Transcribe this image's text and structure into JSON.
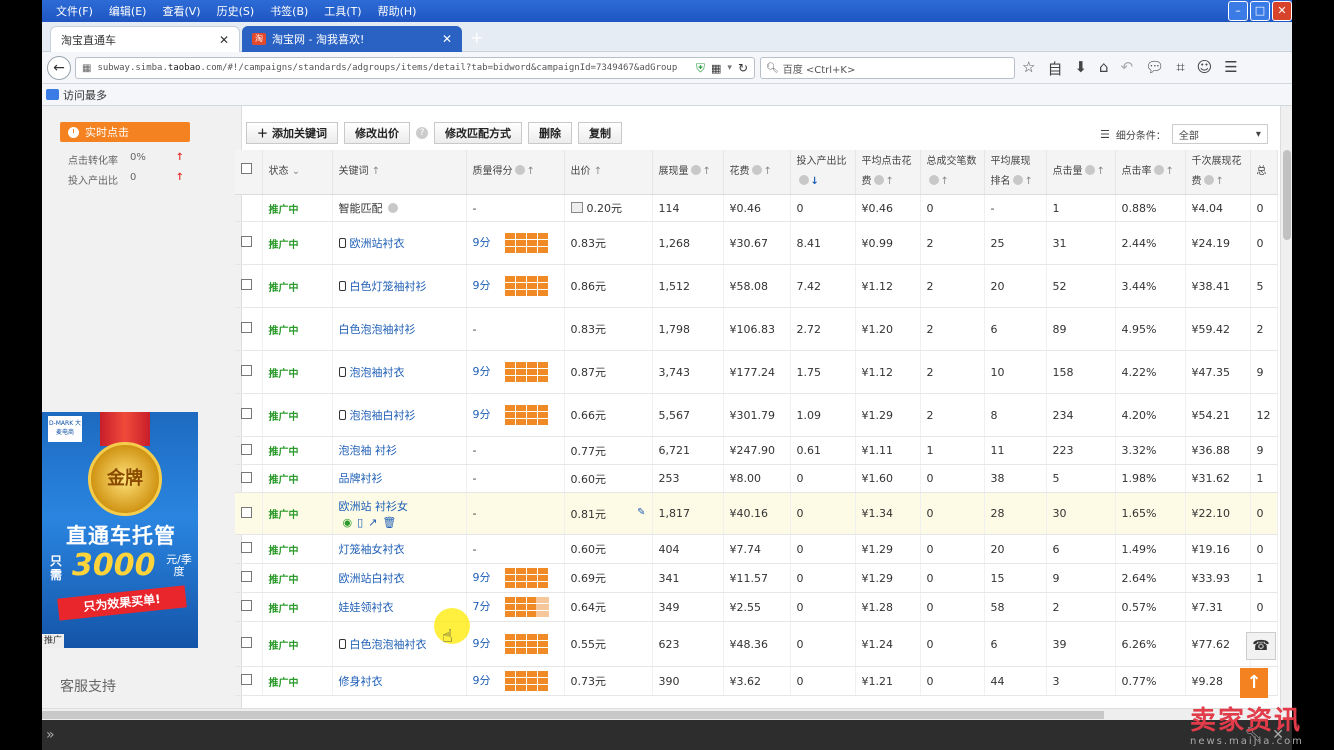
{
  "browser": {
    "menu": [
      "文件(F)",
      "编辑(E)",
      "查看(V)",
      "历史(S)",
      "书签(B)",
      "工具(T)",
      "帮助(H)"
    ],
    "tabs": [
      {
        "label": "淘宝直通车",
        "active": true
      },
      {
        "label": "淘宝网 - 淘我喜欢!",
        "active": false
      }
    ],
    "url_prefix": "subway.simba.",
    "url_domain": "taobao",
    "url_rest": ".com/#!/campaigns/standards/adgroups/items/detail?tab=bidword&campaignId=7349467&adGroup",
    "search_placeholder": "百度 <Ctrl+K>",
    "bookmark": "访问最多"
  },
  "sidebar": {
    "realtime_label": "实时点击",
    "stats": [
      {
        "label": "点击转化率",
        "value": "0%"
      },
      {
        "label": "投入产出比",
        "value": "0"
      }
    ],
    "ad": {
      "logo": "D-MARK 大麦电商",
      "medal": "金牌",
      "headline": "直通车托管",
      "only": "只需",
      "price": "3000",
      "unit": "元/季度",
      "slogan": "只为效果买单!",
      "tag": "推广"
    },
    "support": "客服支持"
  },
  "toolbar": {
    "add_keyword": "添加关键词",
    "modify_bid": "修改出价",
    "modify_match": "修改匹配方式",
    "delete": "删除",
    "copy": "复制",
    "filter_label": "细分条件：",
    "filter_value": "全部"
  },
  "columns": [
    "状态",
    "关键词",
    "质量得分",
    "出价",
    "展现量",
    "花费",
    "投入产出比",
    "平均点击花费",
    "总成交笔数",
    "平均展现排名",
    "点击量",
    "点击率",
    "千次展现花费",
    "总"
  ],
  "rows": [
    {
      "status": "推广中",
      "keyword": "智能匹配",
      "mobile": false,
      "quality": "-",
      "bid": "0.20元",
      "impressions": "114",
      "cost": "¥0.46",
      "roi": "0",
      "cpc": "¥0.46",
      "deals": "0",
      "rank": "-",
      "clicks": "1",
      "ctr": "0.88%",
      "cpm": "¥4.04",
      "total": "0"
    },
    {
      "status": "推广中",
      "keyword": "欧洲站衬衣",
      "mobile": true,
      "quality": "9分",
      "bid": "0.83元",
      "impressions": "1,268",
      "cost": "¥30.67",
      "roi": "8.41",
      "cpc": "¥0.99",
      "deals": "2",
      "rank": "25",
      "clicks": "31",
      "ctr": "2.44%",
      "cpm": "¥24.19",
      "total": "0"
    },
    {
      "status": "推广中",
      "keyword": "白色灯笼袖衬衫",
      "mobile": true,
      "quality": "9分",
      "bid": "0.86元",
      "impressions": "1,512",
      "cost": "¥58.08",
      "roi": "7.42",
      "cpc": "¥1.12",
      "deals": "2",
      "rank": "20",
      "clicks": "52",
      "ctr": "3.44%",
      "cpm": "¥38.41",
      "total": "5"
    },
    {
      "status": "推广中",
      "keyword": "白色泡泡袖衬衫",
      "mobile": false,
      "quality": "-",
      "bid": "0.83元",
      "impressions": "1,798",
      "cost": "¥106.83",
      "roi": "2.72",
      "cpc": "¥1.20",
      "deals": "2",
      "rank": "6",
      "clicks": "89",
      "ctr": "4.95%",
      "cpm": "¥59.42",
      "total": "2"
    },
    {
      "status": "推广中",
      "keyword": "泡泡袖衬衣",
      "mobile": true,
      "quality": "9分",
      "bid": "0.87元",
      "impressions": "3,743",
      "cost": "¥177.24",
      "roi": "1.75",
      "cpc": "¥1.12",
      "deals": "2",
      "rank": "10",
      "clicks": "158",
      "ctr": "4.22%",
      "cpm": "¥47.35",
      "total": "9"
    },
    {
      "status": "推广中",
      "keyword": "泡泡袖白衬衫",
      "mobile": true,
      "quality": "9分",
      "bid": "0.66元",
      "impressions": "5,567",
      "cost": "¥301.79",
      "roi": "1.09",
      "cpc": "¥1.29",
      "deals": "2",
      "rank": "8",
      "clicks": "234",
      "ctr": "4.20%",
      "cpm": "¥54.21",
      "total": "12"
    },
    {
      "status": "推广中",
      "keyword": "泡泡袖 衬衫",
      "mobile": false,
      "quality": "-",
      "bid": "0.77元",
      "impressions": "6,721",
      "cost": "¥247.90",
      "roi": "0.61",
      "cpc": "¥1.11",
      "deals": "1",
      "rank": "11",
      "clicks": "223",
      "ctr": "3.32%",
      "cpm": "¥36.88",
      "total": "9"
    },
    {
      "status": "推广中",
      "keyword": "品牌衬衫",
      "mobile": false,
      "quality": "-",
      "bid": "0.60元",
      "impressions": "253",
      "cost": "¥8.00",
      "roi": "0",
      "cpc": "¥1.60",
      "deals": "0",
      "rank": "38",
      "clicks": "5",
      "ctr": "1.98%",
      "cpm": "¥31.62",
      "total": "1"
    },
    {
      "status": "推广中",
      "keyword": "欧洲站 衬衫女",
      "mobile": false,
      "quality": "-",
      "bid": "0.81元",
      "impressions": "1,817",
      "cost": "¥40.16",
      "roi": "0",
      "cpc": "¥1.34",
      "deals": "0",
      "rank": "28",
      "clicks": "30",
      "ctr": "1.65%",
      "cpm": "¥22.10",
      "total": "0"
    },
    {
      "status": "推广中",
      "keyword": "灯笼袖女衬衣",
      "mobile": false,
      "quality": "-",
      "bid": "0.60元",
      "impressions": "404",
      "cost": "¥7.74",
      "roi": "0",
      "cpc": "¥1.29",
      "deals": "0",
      "rank": "20",
      "clicks": "6",
      "ctr": "1.49%",
      "cpm": "¥19.16",
      "total": "0"
    },
    {
      "status": "推广中",
      "keyword": "欧洲站白衬衣",
      "mobile": false,
      "quality": "9分",
      "bid": "0.69元",
      "impressions": "341",
      "cost": "¥11.57",
      "roi": "0",
      "cpc": "¥1.29",
      "deals": "0",
      "rank": "15",
      "clicks": "9",
      "ctr": "2.64%",
      "cpm": "¥33.93",
      "total": "1"
    },
    {
      "status": "推广中",
      "keyword": "娃娃领衬衣",
      "mobile": false,
      "quality": "7分",
      "bid": "0.64元",
      "impressions": "349",
      "cost": "¥2.55",
      "roi": "0",
      "cpc": "¥1.28",
      "deals": "0",
      "rank": "58",
      "clicks": "2",
      "ctr": "0.57%",
      "cpm": "¥7.31",
      "total": "0"
    },
    {
      "status": "推广中",
      "keyword": "白色泡泡袖衬衣",
      "mobile": true,
      "quality": "9分",
      "bid": "0.55元",
      "impressions": "623",
      "cost": "¥48.36",
      "roi": "0",
      "cpc": "¥1.24",
      "deals": "0",
      "rank": "6",
      "clicks": "39",
      "ctr": "6.26%",
      "cpm": "¥77.62",
      "total": "0"
    },
    {
      "status": "推广中",
      "keyword": "修身衬衣",
      "mobile": false,
      "quality": "9分",
      "bid": "0.73元",
      "impressions": "390",
      "cost": "¥3.62",
      "roi": "0",
      "cpc": "¥1.21",
      "deals": "0",
      "rank": "44",
      "clicks": "3",
      "ctr": "0.77%",
      "cpm": "¥9.28",
      "total": "0"
    }
  ],
  "watermark": "卖家资讯",
  "watermark_sub": "news.maijia.com",
  "colors": {
    "status_green": "#2a9a2a",
    "link_blue": "#1f5fb6",
    "accent_orange": "#f58220"
  }
}
